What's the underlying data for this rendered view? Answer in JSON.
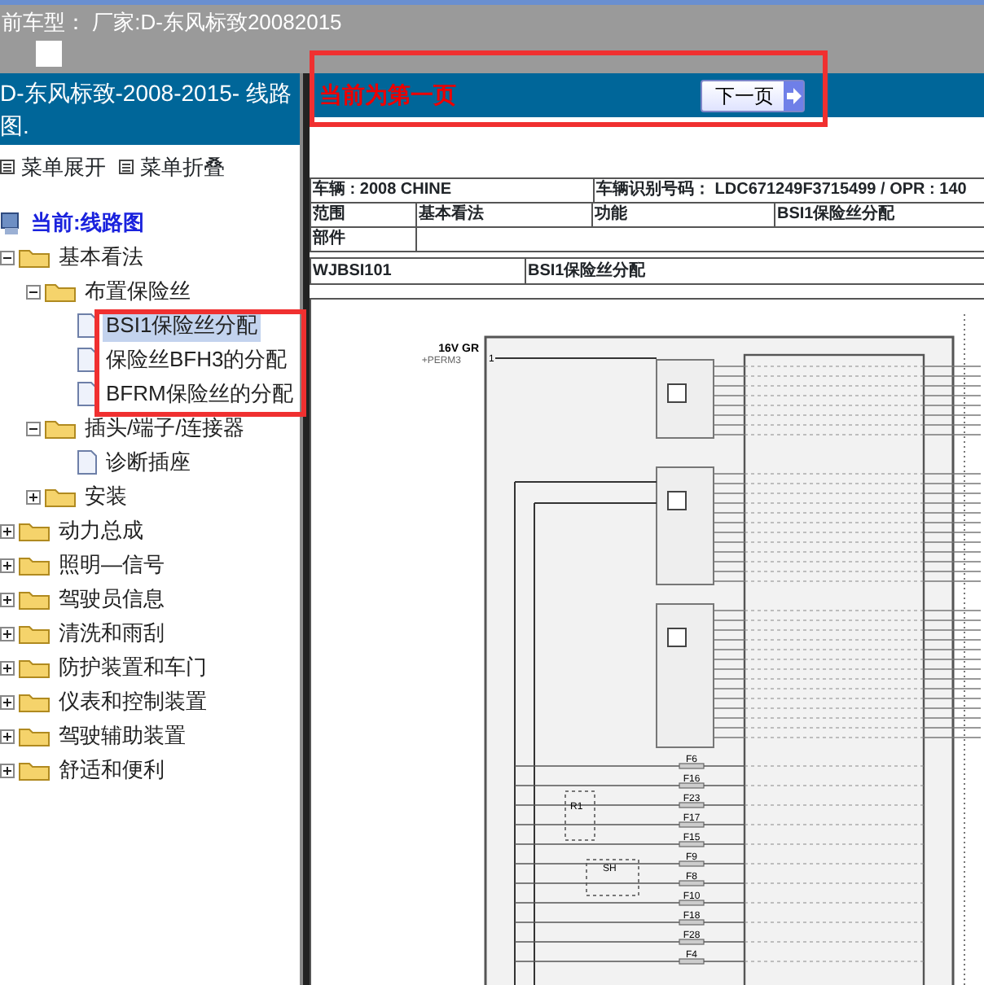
{
  "header": {
    "label": "前车型：",
    "value": "厂家:D-东风标致20082015"
  },
  "sidebar": {
    "title": "D-东风标致-2008-2015- 线路图.",
    "menu_links": [
      "菜单展开",
      "菜单折叠"
    ],
    "tree": [
      {
        "label": "当前:线路图",
        "kind": "root",
        "selected": false,
        "children": [
          {
            "label": "基本看法",
            "kind": "folder",
            "expanded": true,
            "selected": false,
            "children": [
              {
                "label": "布置保险丝",
                "kind": "folder",
                "expanded": true,
                "selected": false,
                "children": [
                  {
                    "label": "BSI1保险丝分配",
                    "kind": "page",
                    "selected": true
                  },
                  {
                    "label": "保险丝BFH3的分配",
                    "kind": "page",
                    "selected": false
                  },
                  {
                    "label": "BFRM保险丝的分配",
                    "kind": "page",
                    "selected": false
                  }
                ]
              },
              {
                "label": "插头/端子/连接器",
                "kind": "folder",
                "expanded": true,
                "selected": false,
                "children": [
                  {
                    "label": "诊断插座",
                    "kind": "page",
                    "selected": false
                  }
                ]
              },
              {
                "label": "安装",
                "kind": "folder",
                "expanded": false,
                "selected": false
              }
            ]
          },
          {
            "label": "动力总成",
            "kind": "folder",
            "expanded": false,
            "selected": false
          },
          {
            "label": "照明—信号",
            "kind": "folder",
            "expanded": false,
            "selected": false
          },
          {
            "label": "驾驶员信息",
            "kind": "folder",
            "expanded": false,
            "selected": false
          },
          {
            "label": "清洗和雨刮",
            "kind": "folder",
            "expanded": false,
            "selected": false
          },
          {
            "label": "防护装置和车门",
            "kind": "folder",
            "expanded": false,
            "selected": false
          },
          {
            "label": "仪表和控制装置",
            "kind": "folder",
            "expanded": false,
            "selected": false
          },
          {
            "label": "驾驶辅助装置",
            "kind": "folder",
            "expanded": false,
            "selected": false
          },
          {
            "label": "舒适和便利",
            "kind": "folder",
            "expanded": false,
            "selected": false
          }
        ]
      }
    ]
  },
  "pager": {
    "status": "当前为第一页",
    "next_button": "下一页"
  },
  "vehicle_info": {
    "vehicle": "车辆 : 2008 CHINE",
    "vin": "车辆识别号码：  LDC671249F3715499 / OPR : 140"
  },
  "scope_info": {
    "scope_label": "范围",
    "scope": "基本看法",
    "function_label": "功能",
    "function": "BSI1保险丝分配"
  },
  "component_info": {
    "label": "部件"
  },
  "diagram_title": {
    "code": "WJBSI101",
    "name": "BSI1保险丝分配"
  },
  "diagram": {
    "supply_label": "16V GR",
    "supply_name": "+PERM3",
    "pin": "1",
    "relay_label": "R1",
    "shunt_label": "SH",
    "fuses": [
      "F6",
      "F16",
      "F23",
      "F17",
      "F15",
      "F9",
      "F8",
      "F10",
      "F18",
      "F28",
      "F4"
    ]
  }
}
